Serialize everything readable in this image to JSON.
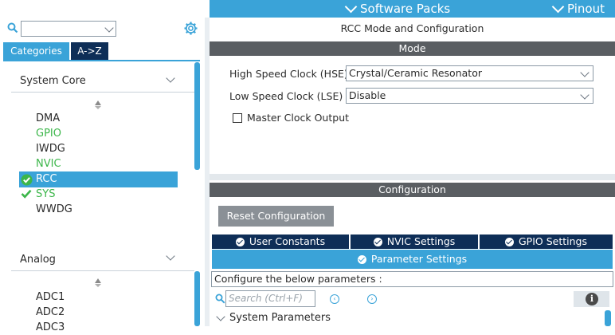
{
  "topbar": {
    "software_packs": "Software Packs",
    "pinout": "Pinout",
    "accent_color": "#3aa3d8"
  },
  "left": {
    "search": {
      "value": "",
      "placeholder": ""
    },
    "tabs": [
      {
        "label": "Categories",
        "active": true
      },
      {
        "label": "A->Z",
        "active": false
      }
    ],
    "categories": [
      {
        "title": "System Core",
        "items": [
          {
            "label": "DMA",
            "state": "normal"
          },
          {
            "label": "GPIO",
            "state": "green"
          },
          {
            "label": "IWDG",
            "state": "normal"
          },
          {
            "label": "NVIC",
            "state": "green"
          },
          {
            "label": "RCC",
            "state": "selected-checked"
          },
          {
            "label": "SYS",
            "state": "checked-green"
          },
          {
            "label": "WWDG",
            "state": "normal"
          }
        ]
      },
      {
        "title": "Analog",
        "items": [
          {
            "label": "ADC1",
            "state": "normal"
          },
          {
            "label": "ADC2",
            "state": "normal"
          },
          {
            "label": "ADC3",
            "state": "normal"
          }
        ]
      }
    ]
  },
  "right": {
    "title": "RCC Mode and Configuration",
    "mode_header": "Mode",
    "hse": {
      "label": "High Speed Clock (HSE)",
      "value": "Crystal/Ceramic Resonator"
    },
    "lse": {
      "label": "Low Speed Clock (LSE)",
      "value": "Disable"
    },
    "mco": {
      "label": "Master Clock Output",
      "checked": false
    },
    "config_header": "Configuration",
    "reset_button": "Reset Configuration",
    "tabs": [
      {
        "label": "User Constants"
      },
      {
        "label": "NVIC Settings"
      },
      {
        "label": "GPIO Settings"
      }
    ],
    "active_tab": "Parameter Settings",
    "configure_text": "Configure the below parameters :",
    "param_search_placeholder": "Search (Ctrl+F)",
    "group_title": "System Parameters"
  }
}
